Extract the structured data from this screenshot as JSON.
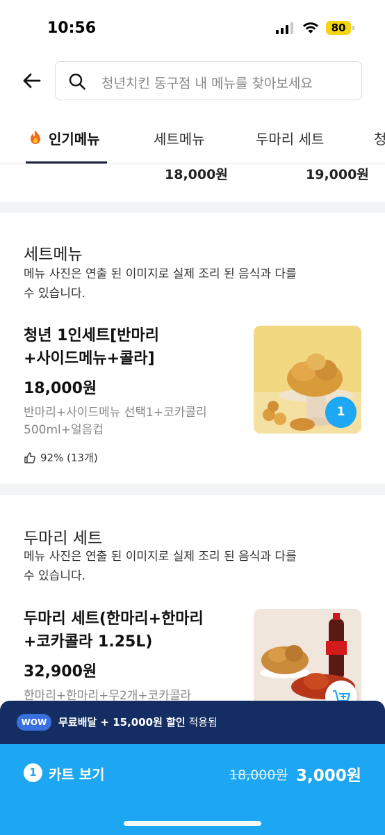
{
  "status_bar": {
    "time": "10:56",
    "battery": "80"
  },
  "search": {
    "placeholder": "청년치킨 동구점 내 메뉴를 찾아보세요"
  },
  "tabs": [
    {
      "label": "인기메뉴",
      "active": true
    },
    {
      "label": "세트메뉴"
    },
    {
      "label": "두마리 세트"
    },
    {
      "label": "청"
    }
  ],
  "top_prices": [
    "18,000원",
    "19,000원"
  ],
  "sections": [
    {
      "title": "세트메뉴",
      "desc_line1": "메뉴 사진은 연출 된 이미지로 실제 조리 된 음식과 다를",
      "desc_line2": "수 있습니다.",
      "item": {
        "name_line1": "청년 1인세트[반마리",
        "name_line2": "+사이드메뉴+콜라]",
        "price": "18,000원",
        "desc_line1": "반마리+사이드메뉴 선택1+코카콜리",
        "desc_line2": "500ml+얼음컵",
        "likes": "92% (13개)",
        "cart_qty": "1"
      }
    },
    {
      "title": "두마리 세트",
      "desc_line1": "메뉴 사진은 연출 된 이미지로 실제 조리 된 음식과 다를",
      "desc_line2": "수 있습니다.",
      "item": {
        "name_line1": "두마리 세트(한마리+한마리",
        "name_line2": "+코카콜라 1.25L)",
        "price": "32,900원",
        "desc_line1": "한마리+한마리+무2개+코카콜라"
      }
    }
  ],
  "wow_bar": {
    "badge": "WOW",
    "text_bold": "무료배달 + 15,000원 할인",
    "text_rest": " 적용됨"
  },
  "cart_bar": {
    "count": "1",
    "label": "카트 보기",
    "old_price": "18,000원",
    "new_price": "3,000원"
  },
  "colors": {
    "accent": "#1da7f2",
    "wow_navy": "#142d63",
    "tab_underline": "#1a1f3a"
  }
}
